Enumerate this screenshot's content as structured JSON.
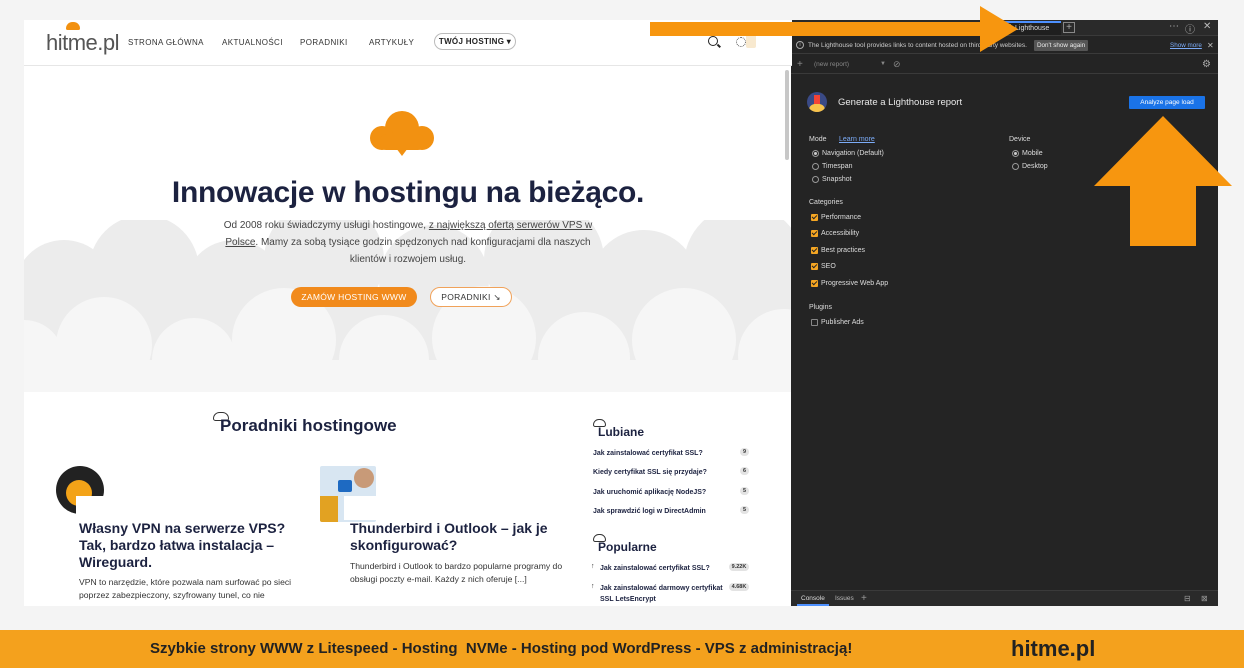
{
  "site": {
    "logo": "hitme.pl",
    "nav": [
      "STRONA GŁÓWNA",
      "AKTUALNOŚCI",
      "PORADNIKI",
      "ARTYKUŁY"
    ],
    "nav_dropdown": "TWÓJ HOSTING ▾",
    "hero": {
      "title": "Innowacje w hostingu na bieżąco.",
      "desc_part1": "Od 2008 roku świadczymy usługi hostingowe, ",
      "desc_link": "z największą ofertą serwerów VPS w Polsce",
      "desc_part2": ". Mamy za sobą tysiące godzin spędzonych nad konfiguracjami dla naszych klientów i rozwojem usług.",
      "cta_primary": "ZAMÓW HOSTING WWW",
      "cta_secondary": "PORADNIKI ↘"
    },
    "guides_title": "Poradniki hostingowe",
    "cards": [
      {
        "title": "Własny VPN na serwerze VPS? Tak, bardzo łatwa instalacja – Wireguard.",
        "text": "VPN to narzędzie, które pozwala nam surfować po sieci poprzez zabezpieczony, szyfrowany tunel, co nie"
      },
      {
        "title": "Thunderbird i Outlook – jak je skonfigurować?",
        "text": "Thunderbird i Outlook to bardzo popularne programy do obsługi poczty e-mail. Każdy z nich oferuje [...]"
      }
    ],
    "liked_title": "Lubiane",
    "liked": [
      {
        "label": "Jak zainstalować certyfikat SSL?",
        "count": "9"
      },
      {
        "label": "Kiedy certyfikat SSL się przydaje?",
        "count": "6"
      },
      {
        "label": "Jak uruchomić aplikację NodeJS?",
        "count": "5"
      },
      {
        "label": "Jak sprawdzić logi w DirectAdmin",
        "count": "5"
      }
    ],
    "popular_title": "Popularne",
    "popular": [
      {
        "label": "Jak zainstalować certyfikat SSL?",
        "count": "9.22K"
      },
      {
        "label": "Jak zainstalować darmowy certyfikat SSL LetsEncrypt",
        "count": "4.68K"
      }
    ]
  },
  "devtools": {
    "tab": "Lighthouse",
    "info": "The Lighthouse tool provides links to content hosted on third-party websites.",
    "dont_show": "Don't show again",
    "show_more": "Show more",
    "report_select": "(new report)",
    "title": "Generate a Lighthouse report",
    "analyze": "Analyze page load",
    "mode_label": "Mode",
    "learn_more": "Learn more",
    "modes": [
      "Navigation (Default)",
      "Timespan",
      "Snapshot"
    ],
    "device_label": "Device",
    "devices": [
      "Mobile",
      "Desktop"
    ],
    "categories_label": "Categories",
    "categories": [
      "Performance",
      "Accessibility",
      "Best practices",
      "SEO",
      "Progressive Web App"
    ],
    "plugins_label": "Plugins",
    "plugins": [
      "Publisher Ads"
    ],
    "drawer": [
      "Console",
      "Issues"
    ]
  },
  "banner": {
    "text": "Szybkie strony WWW z Litespeed - Hosting  NVMe - Hosting pod WordPress - VPS z administracją!",
    "brand": "hitme.pl"
  },
  "colors": {
    "accent_orange": "#f4a11d",
    "devtools_bg": "#242424",
    "link_blue": "#1a73e8"
  }
}
